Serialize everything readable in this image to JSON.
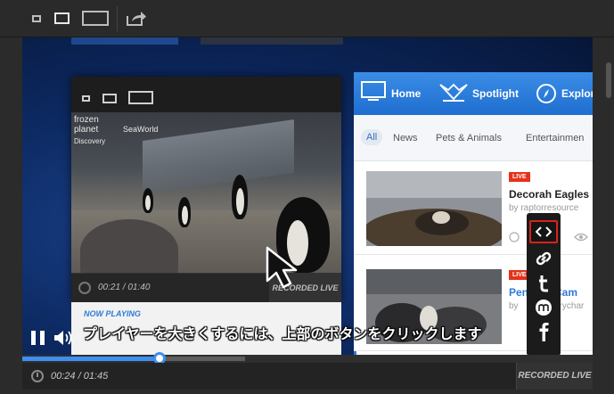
{
  "top_toolbar": {
    "share_icon": "share-arrow-icon"
  },
  "inner_player": {
    "brand_lines": [
      "frozen",
      "planet",
      "Discovery",
      "SeaWorld"
    ],
    "time": "00:21 / 01:40",
    "badge": "RECORDED LIVE",
    "now_playing_label": "NOW PLAYING"
  },
  "explorer": {
    "nav": [
      {
        "label": "Home",
        "icon": "monitor-icon"
      },
      {
        "label": "Spotlight",
        "icon": "spotlight-icon"
      },
      {
        "label": "Explor",
        "icon": "compass-icon"
      }
    ],
    "filters": [
      "All",
      "News",
      "Pets & Animals",
      "Entertainmen"
    ],
    "cards": [
      {
        "live": "LIVE",
        "title": "Decorah Eagles",
        "subtitle": "by raptorresource"
      },
      {
        "live": "LIVE",
        "title": "Pen",
        "title2": "Cam",
        "subtitle": "by",
        "subtitle2": "erychar"
      }
    ]
  },
  "share_bar": {
    "items": [
      "embed-icon",
      "link-icon",
      "tumblr-icon",
      "mixi-icon",
      "facebook-icon"
    ]
  },
  "subtitle": "プレイヤーを大きくするには、上部のボタンをクリックします",
  "player": {
    "time": "00:24 / 01:45",
    "badge": "RECORDED LIVE",
    "progress_played_fraction": 0.24,
    "progress_buffered_fraction": 0.39
  },
  "colors": {
    "accent_blue": "#3d8ff0",
    "live_red": "#e5321a",
    "highlight_red": "#d8221b"
  }
}
